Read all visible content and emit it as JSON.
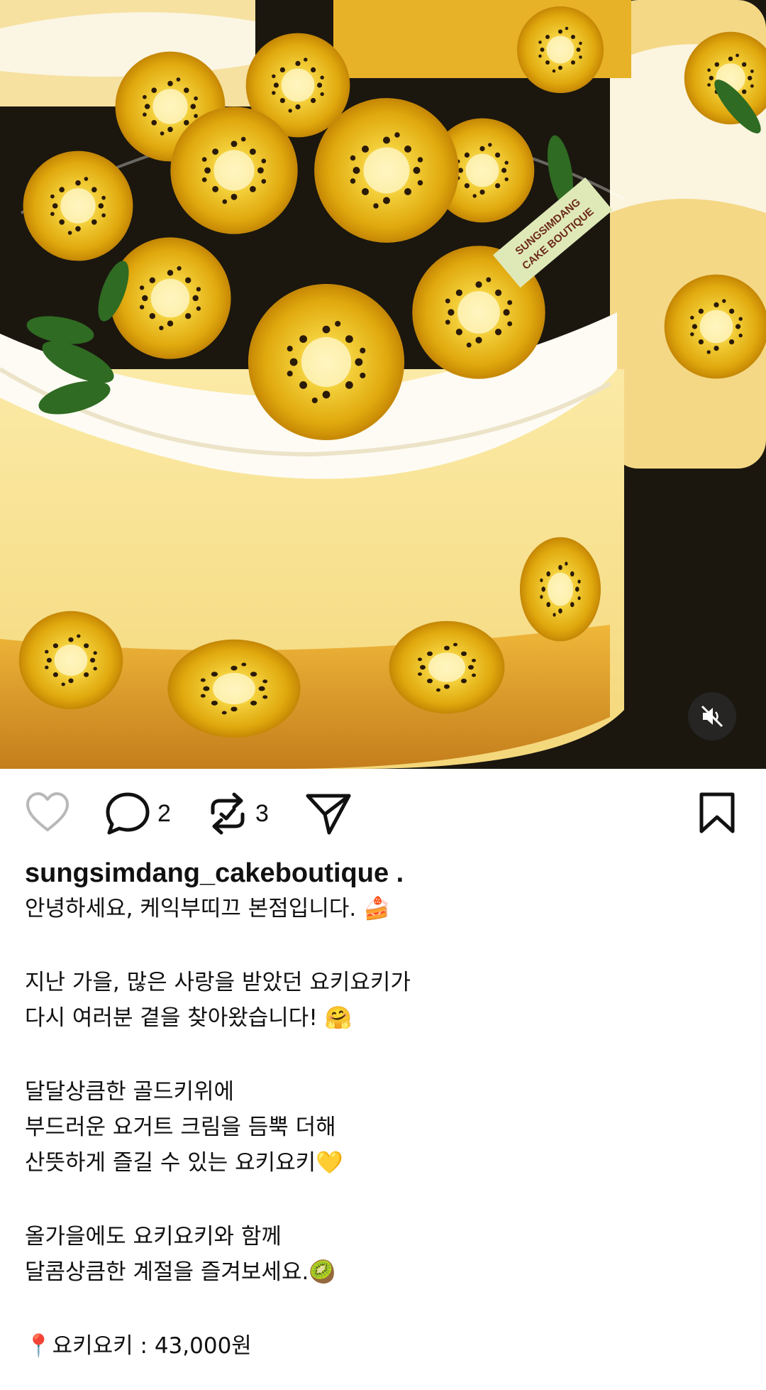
{
  "post": {
    "media_label": "SUNGSIMDANG CAKE BOUTIQUE",
    "media_label_line1": "SUNGSIMDANG",
    "media_label_line2": "CAKE BOUTIQUE",
    "mute_icon": "speaker-muted-icon"
  },
  "actions": {
    "like_icon": "heart-outline-icon",
    "comment_icon": "comment-bubble-icon",
    "comment_count": "2",
    "repost_icon": "repost-icon",
    "repost_count": "3",
    "share_icon": "paper-plane-icon",
    "save_icon": "bookmark-outline-icon"
  },
  "caption": {
    "username": "sungsimdang_cakeboutique .",
    "greeting": "안녕하세요, 케익부띠끄 본점입니다. 🍰",
    "p1_l1": "지난 가을, 많은 사랑을 받았던 요키요키가",
    "p1_l2": "다시 여러분 곁을 찾아왔습니다! 🤗",
    "p2_l1": "달달상큼한 골드키위에",
    "p2_l2": "부드러운 요거트 크림을 듬뿍 더해",
    "p2_l3": "산뜻하게 즐길 수 있는 요키요키💛",
    "p3_l1": "올가을에도 요키요키와 함께",
    "p3_l2": "달콤상큼한 계절을 즐겨보세요.🥝",
    "price": "📍요키요키 : 43,000원"
  }
}
